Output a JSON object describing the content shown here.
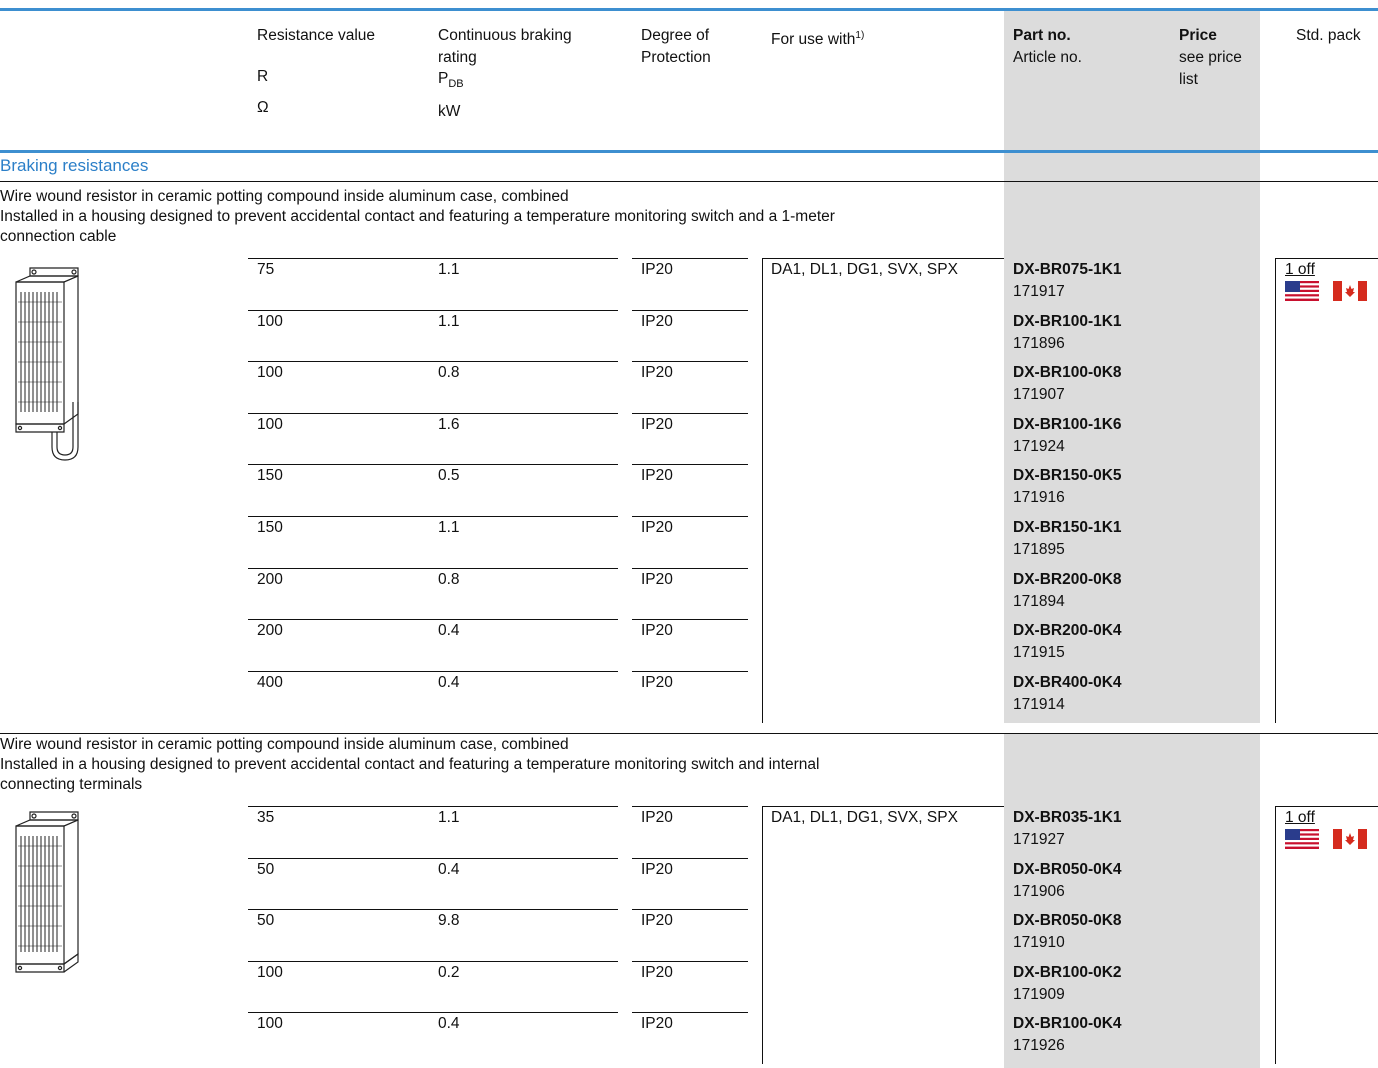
{
  "header": {
    "resistance": "Resistance value",
    "resistance_sym": "R",
    "resistance_unit": "Ω",
    "braking_l1": "Continuous braking",
    "braking_l2": "rating",
    "braking_sym": "P",
    "braking_sub": "DB",
    "braking_unit": "kW",
    "protection_l1": "Degree of",
    "protection_l2": "Protection",
    "use_with": "For use with",
    "use_with_sup": "1)",
    "part_no": "Part no.",
    "article_no": "Article no.",
    "price": "Price",
    "price_l2": "see price",
    "price_l3": "list",
    "std_pack": "Std. pack"
  },
  "section_title": "Braking resistances",
  "groups": [
    {
      "desc1": "Wire wound resistor in ceramic potting compound inside aluminum case, combined",
      "desc2": "Installed in a housing designed to prevent accidental contact and featuring a temperature monitoring switch and a 1-meter",
      "desc3": "connection cable",
      "use_with": "DA1, DL1, DG1, SVX, SPX",
      "std_pack": "1 off",
      "rows": [
        {
          "r": "75",
          "p": "1.1",
          "ip": "IP20",
          "part": "DX-BR075-1K1",
          "art": "171917"
        },
        {
          "r": "100",
          "p": "1.1",
          "ip": "IP20",
          "part": "DX-BR100-1K1",
          "art": "171896"
        },
        {
          "r": "100",
          "p": "0.8",
          "ip": "IP20",
          "part": "DX-BR100-0K8",
          "art": "171907"
        },
        {
          "r": "100",
          "p": "1.6",
          "ip": "IP20",
          "part": "DX-BR100-1K6",
          "art": "171924"
        },
        {
          "r": "150",
          "p": "0.5",
          "ip": "IP20",
          "part": "DX-BR150-0K5",
          "art": "171916"
        },
        {
          "r": "150",
          "p": "1.1",
          "ip": "IP20",
          "part": "DX-BR150-1K1",
          "art": "171895"
        },
        {
          "r": "200",
          "p": "0.8",
          "ip": "IP20",
          "part": "DX-BR200-0K8",
          "art": "171894"
        },
        {
          "r": "200",
          "p": "0.4",
          "ip": "IP20",
          "part": "DX-BR200-0K4",
          "art": "171915"
        },
        {
          "r": "400",
          "p": "0.4",
          "ip": "IP20",
          "part": "DX-BR400-0K4",
          "art": "171914"
        }
      ]
    },
    {
      "desc1": "Wire wound resistor in ceramic potting compound inside aluminum case, combined",
      "desc2": "Installed in a housing designed to prevent accidental contact and featuring a temperature monitoring switch and internal",
      "desc3": "connecting terminals",
      "use_with": "DA1, DL1, DG1, SVX, SPX",
      "std_pack": "1 off",
      "rows": [
        {
          "r": "35",
          "p": "1.1",
          "ip": "IP20",
          "part": "DX-BR035-1K1",
          "art": "171927"
        },
        {
          "r": "50",
          "p": "0.4",
          "ip": "IP20",
          "part": "DX-BR050-0K4",
          "art": "171906"
        },
        {
          "r": "50",
          "p": "9.8",
          "ip": "IP20",
          "part": "DX-BR050-0K8",
          "art": "171910"
        },
        {
          "r": "100",
          "p": "0.2",
          "ip": "IP20",
          "part": "DX-BR100-0K2",
          "art": "171909"
        },
        {
          "r": "100",
          "p": "0.4",
          "ip": "IP20",
          "part": "DX-BR100-0K4",
          "art": "171926"
        }
      ]
    }
  ],
  "colors": {
    "accent": "#3d8fd0",
    "shade": "#dcdcdc"
  }
}
